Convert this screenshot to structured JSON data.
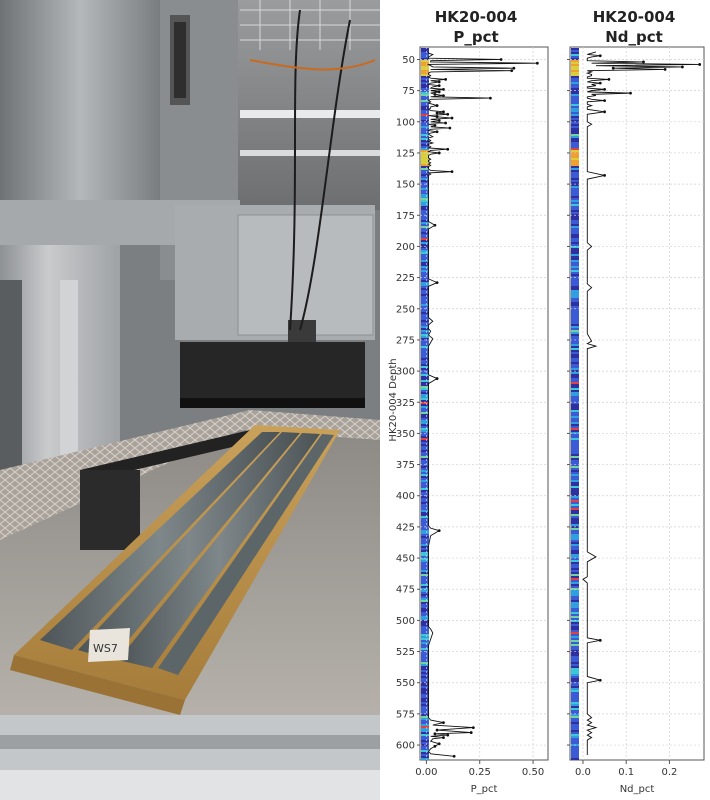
{
  "colors": {
    "background": "#ffffff",
    "data_line": "#111111",
    "grid": "#d0d0d0",
    "strip_palette": [
      "#2e2fa0",
      "#3b5bd6",
      "#2f9fe0",
      "#3cc7d9",
      "#6fd3a0",
      "#d9cf3c",
      "#f0a030",
      "#e04040"
    ]
  },
  "photo": {
    "subject": "core-scanner",
    "box_label": "WS7"
  },
  "chart_data": [
    {
      "type": "line",
      "orientation": "vertical",
      "title_line1": "HK20-004",
      "title_line2": "P_pct",
      "xlabel": "P_pct",
      "ylabel": "HK20-004 Depth",
      "xlim": [
        -0.03,
        0.57
      ],
      "ylim": [
        612,
        40
      ],
      "xticks": [
        "0.00",
        "0.25",
        "0.50"
      ],
      "xtick_values": [
        0.0,
        0.25,
        0.5
      ],
      "yticks": [
        50,
        75,
        100,
        125,
        150,
        175,
        200,
        225,
        250,
        275,
        300,
        325,
        350,
        375,
        400,
        425,
        450,
        475,
        500,
        525,
        550,
        575,
        600
      ],
      "grid": true,
      "series": [
        {
          "depth": [
            44,
            45,
            46,
            47,
            48,
            49,
            50,
            51,
            52,
            53,
            54,
            55,
            56,
            57,
            58,
            59,
            60,
            61,
            62,
            63,
            64,
            65,
            66,
            67,
            68,
            69,
            70,
            71,
            72,
            73,
            74,
            75,
            76,
            77,
            78,
            79,
            80,
            81,
            82,
            83,
            84,
            85,
            86,
            87,
            88,
            89,
            90,
            91,
            92,
            93,
            94,
            95,
            96,
            97,
            98,
            99,
            100,
            101,
            102,
            103,
            104,
            105,
            106,
            107,
            108,
            109,
            110,
            111,
            112,
            113,
            114,
            115,
            116,
            117,
            118,
            119,
            120,
            121,
            122,
            123,
            124,
            125,
            126,
            127,
            128,
            129,
            130,
            131,
            132,
            133,
            134,
            135,
            136,
            137,
            138,
            139,
            140,
            141,
            142,
            143,
            144,
            145,
            150,
            160,
            170,
            180,
            183,
            186,
            189,
            192,
            200,
            210,
            220,
            226,
            229,
            232,
            235,
            240,
            250,
            257,
            260,
            263,
            266,
            268,
            271,
            274,
            280,
            290,
            300,
            303,
            306,
            310,
            320,
            330,
            340,
            350,
            360,
            370,
            380,
            390,
            400,
            410,
            420,
            424,
            426,
            428,
            432,
            440,
            450,
            460,
            470,
            480,
            490,
            500,
            503,
            505,
            507,
            510,
            520,
            530,
            540,
            550,
            560,
            570,
            575,
            578,
            580,
            582,
            584,
            586,
            588,
            590,
            591,
            592,
            593,
            594,
            595,
            597,
            599,
            601,
            603,
            605,
            607,
            609
          ],
          "values": [
            0.01,
            0.01,
            0.03,
            0.02,
            0.01,
            0.01,
            0.35,
            0.02,
            0.02,
            0.52,
            0.01,
            0.02,
            0.03,
            0.41,
            0.02,
            0.4,
            0.02,
            0.01,
            0.01,
            0.02,
            0.01,
            0.02,
            0.09,
            0.02,
            0.06,
            0.02,
            0.01,
            0.06,
            0.03,
            0.02,
            0.08,
            0.02,
            0.06,
            0.02,
            0.04,
            0.08,
            0.02,
            0.3,
            0.02,
            0.01,
            0.02,
            0.01,
            0.03,
            0.05,
            0.02,
            0.02,
            0.01,
            0.02,
            0.08,
            0.05,
            0.1,
            0.01,
            0.05,
            0.12,
            0.02,
            0.06,
            0.02,
            0.09,
            0.01,
            0.04,
            0.02,
            0.11,
            0.02,
            0.01,
            0.05,
            0.02,
            0.01,
            0.02,
            0.03,
            0.01,
            0.01,
            0.02,
            0.01,
            0.03,
            0.01,
            0.01,
            0.02,
            0.01,
            0.1,
            0.02,
            0.01,
            0.06,
            0.02,
            0.01,
            0.01,
            0.01,
            0.02,
            0.01,
            0.01,
            0.02,
            0.01,
            0.02,
            0.01,
            0.01,
            0.01,
            0.02,
            0.12,
            0.01,
            0.02,
            0.01,
            0.01,
            0.01,
            0.01,
            0.01,
            0.01,
            0.01,
            0.04,
            0.01,
            0.01,
            0.01,
            0.01,
            0.01,
            0.01,
            0.01,
            0.05,
            0.01,
            0.01,
            0.01,
            0.01,
            0.01,
            0.03,
            0.01,
            0.01,
            0.02,
            0.01,
            0.03,
            0.01,
            0.01,
            0.01,
            0.01,
            0.05,
            0.01,
            0.01,
            0.01,
            0.01,
            0.01,
            0.01,
            0.01,
            0.01,
            0.01,
            0.01,
            0.01,
            0.01,
            0.01,
            0.02,
            0.06,
            0.02,
            0.01,
            0.01,
            0.01,
            0.01,
            0.01,
            0.01,
            0.01,
            0.01,
            0.01,
            0.02,
            0.03,
            0.01,
            0.01,
            0.01,
            0.01,
            0.01,
            0.01,
            0.01,
            0.01,
            0.02,
            0.08,
            0.03,
            0.22,
            0.05,
            0.21,
            0.04,
            0.1,
            0.02,
            0.08,
            0.03,
            0.02,
            0.06,
            0.04,
            0.02,
            0.01,
            0.02,
            0.13,
            0.02,
            0.01,
            0.01
          ]
        }
      ]
    },
    {
      "type": "line",
      "orientation": "vertical",
      "title_line1": "HK20-004",
      "title_line2": "Nd_pct",
      "xlabel": "Nd_pct",
      "ylabel": "",
      "xlim": [
        -0.03,
        0.28
      ],
      "ylim": [
        612,
        40
      ],
      "xticks": [
        "0.0",
        "0.1",
        "0.2"
      ],
      "xtick_values": [
        0.0,
        0.1,
        0.2
      ],
      "yticks": [
        50,
        75,
        100,
        125,
        150,
        175,
        200,
        225,
        250,
        275,
        300,
        325,
        350,
        375,
        400,
        425,
        450,
        475,
        500,
        525,
        550,
        575,
        600
      ],
      "grid": true,
      "series": [
        {
          "depth": [
            44,
            45,
            46,
            47,
            48,
            49,
            50,
            51,
            52,
            53,
            54,
            55,
            56,
            57,
            58,
            59,
            60,
            61,
            62,
            63,
            64,
            65,
            66,
            67,
            68,
            69,
            70,
            71,
            72,
            73,
            74,
            75,
            76,
            77,
            78,
            79,
            80,
            81,
            82,
            83,
            84,
            85,
            86,
            87,
            88,
            89,
            90,
            92,
            94,
            96,
            98,
            100,
            102,
            104,
            106,
            108,
            110,
            115,
            120,
            125,
            130,
            135,
            140,
            143,
            146,
            150,
            160,
            170,
            180,
            190,
            197,
            200,
            203,
            210,
            220,
            230,
            233,
            236,
            240,
            250,
            260,
            270,
            276,
            278,
            280,
            282,
            290,
            300,
            310,
            320,
            330,
            340,
            350,
            360,
            370,
            380,
            390,
            400,
            410,
            420,
            430,
            440,
            445,
            449,
            453,
            460,
            465,
            467,
            470,
            480,
            490,
            500,
            510,
            514,
            516,
            518,
            520,
            530,
            540,
            545,
            548,
            550,
            560,
            570,
            575,
            578,
            580,
            582,
            584,
            586,
            588,
            590,
            592,
            594,
            596,
            598,
            600,
            602,
            604,
            606,
            608
          ],
          "values": [
            0.03,
            0.02,
            0.01,
            0.04,
            0.02,
            0.01,
            0.01,
            0.01,
            0.14,
            0.02,
            0.27,
            0.03,
            0.23,
            0.07,
            0.19,
            0.01,
            0.02,
            0.01,
            0.02,
            0.02,
            0.01,
            0.01,
            0.06,
            0.02,
            0.01,
            0.04,
            0.02,
            0.03,
            0.01,
            0.01,
            0.05,
            0.02,
            0.01,
            0.11,
            0.02,
            0.03,
            0.01,
            0.01,
            0.02,
            0.05,
            0.01,
            0.01,
            0.01,
            0.02,
            0.01,
            0.01,
            0.01,
            0.05,
            0.01,
            0.01,
            0.01,
            0.01,
            0.02,
            0.01,
            0.01,
            0.01,
            0.01,
            0.01,
            0.01,
            0.01,
            0.01,
            0.01,
            0.01,
            0.05,
            0.01,
            0.01,
            0.01,
            0.01,
            0.01,
            0.01,
            0.01,
            0.02,
            0.01,
            0.01,
            0.01,
            0.01,
            0.02,
            0.01,
            0.01,
            0.01,
            0.01,
            0.01,
            0.02,
            0.01,
            0.03,
            0.01,
            0.01,
            0.01,
            0.01,
            0.01,
            0.01,
            0.01,
            0.01,
            0.01,
            0.01,
            0.01,
            0.01,
            0.01,
            0.01,
            0.01,
            0.01,
            0.01,
            0.01,
            0.03,
            0.01,
            0.01,
            0.01,
            0.0,
            0.01,
            0.01,
            0.01,
            0.01,
            0.01,
            0.01,
            0.04,
            0.01,
            0.01,
            0.01,
            0.01,
            0.01,
            0.04,
            0.01,
            0.01,
            0.01,
            0.01,
            0.02,
            0.01,
            0.02,
            0.01,
            0.03,
            0.01,
            0.02,
            0.01,
            0.02,
            0.01,
            0.01,
            0.01,
            0.01,
            0.01,
            0.01,
            0.01
          ]
        }
      ]
    }
  ]
}
